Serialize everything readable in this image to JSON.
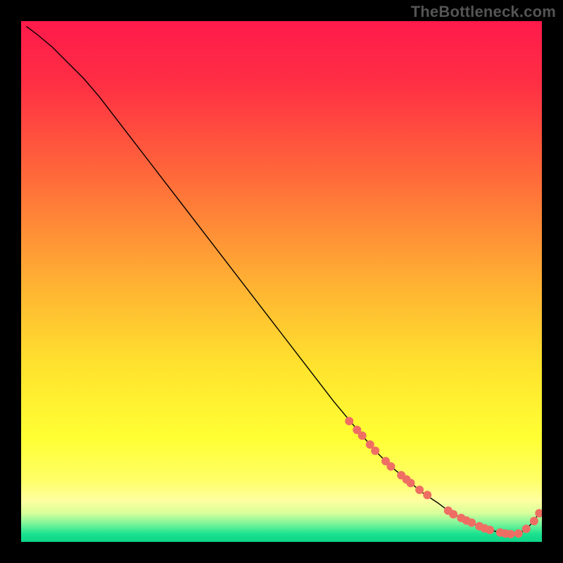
{
  "watermark": "TheBottleneck.com",
  "chart_data": {
    "type": "line",
    "title": "",
    "xlabel": "",
    "ylabel": "",
    "xlim": [
      0,
      100
    ],
    "ylim": [
      0,
      100
    ],
    "background_gradient": {
      "stops": [
        {
          "offset": 0.0,
          "color": "#ff1a4b"
        },
        {
          "offset": 0.12,
          "color": "#ff2f44"
        },
        {
          "offset": 0.3,
          "color": "#ff6a3a"
        },
        {
          "offset": 0.5,
          "color": "#ffb033"
        },
        {
          "offset": 0.66,
          "color": "#ffe22e"
        },
        {
          "offset": 0.8,
          "color": "#ffff33"
        },
        {
          "offset": 0.88,
          "color": "#ffff66"
        },
        {
          "offset": 0.92,
          "color": "#ffffa0"
        },
        {
          "offset": 0.945,
          "color": "#d7ff9a"
        },
        {
          "offset": 0.965,
          "color": "#7cf59a"
        },
        {
          "offset": 0.985,
          "color": "#1ae28f"
        },
        {
          "offset": 1.0,
          "color": "#0fd488"
        }
      ]
    },
    "series": [
      {
        "name": "curve",
        "type": "line",
        "color": "#000000",
        "x": [
          1,
          3,
          6,
          9,
          12,
          15,
          20,
          25,
          30,
          35,
          40,
          45,
          50,
          55,
          60,
          65,
          68,
          71,
          74,
          77,
          80,
          82,
          84,
          86,
          88,
          90,
          92,
          94,
          95,
          96,
          97,
          98,
          99.5
        ],
        "y": [
          99,
          97.5,
          95,
          92,
          89,
          85.5,
          79,
          72.5,
          66,
          59.5,
          53,
          46.5,
          40,
          33.5,
          27,
          21,
          17.5,
          14.5,
          12,
          9.5,
          7.5,
          6,
          4.8,
          3.8,
          3,
          2.3,
          1.8,
          1.5,
          1.5,
          1.8,
          2.5,
          3.5,
          5.5
        ]
      },
      {
        "name": "markers",
        "type": "scatter",
        "color": "#ef6e64",
        "radius": 6,
        "x": [
          63,
          64.5,
          65.5,
          67,
          68,
          70,
          71,
          73,
          74,
          74.8,
          76.5,
          78,
          82,
          83,
          84.5,
          85.5,
          86.5,
          88,
          89,
          90,
          92,
          93,
          94,
          95.5,
          97,
          98.5,
          99.5
        ],
        "y": [
          23.2,
          21.5,
          20.4,
          18.7,
          17.5,
          15.5,
          14.5,
          12.8,
          12,
          11.3,
          10,
          9,
          6,
          5.3,
          4.6,
          4.1,
          3.7,
          3,
          2.6,
          2.3,
          1.8,
          1.6,
          1.5,
          1.6,
          2.5,
          4,
          5.5
        ]
      }
    ]
  }
}
